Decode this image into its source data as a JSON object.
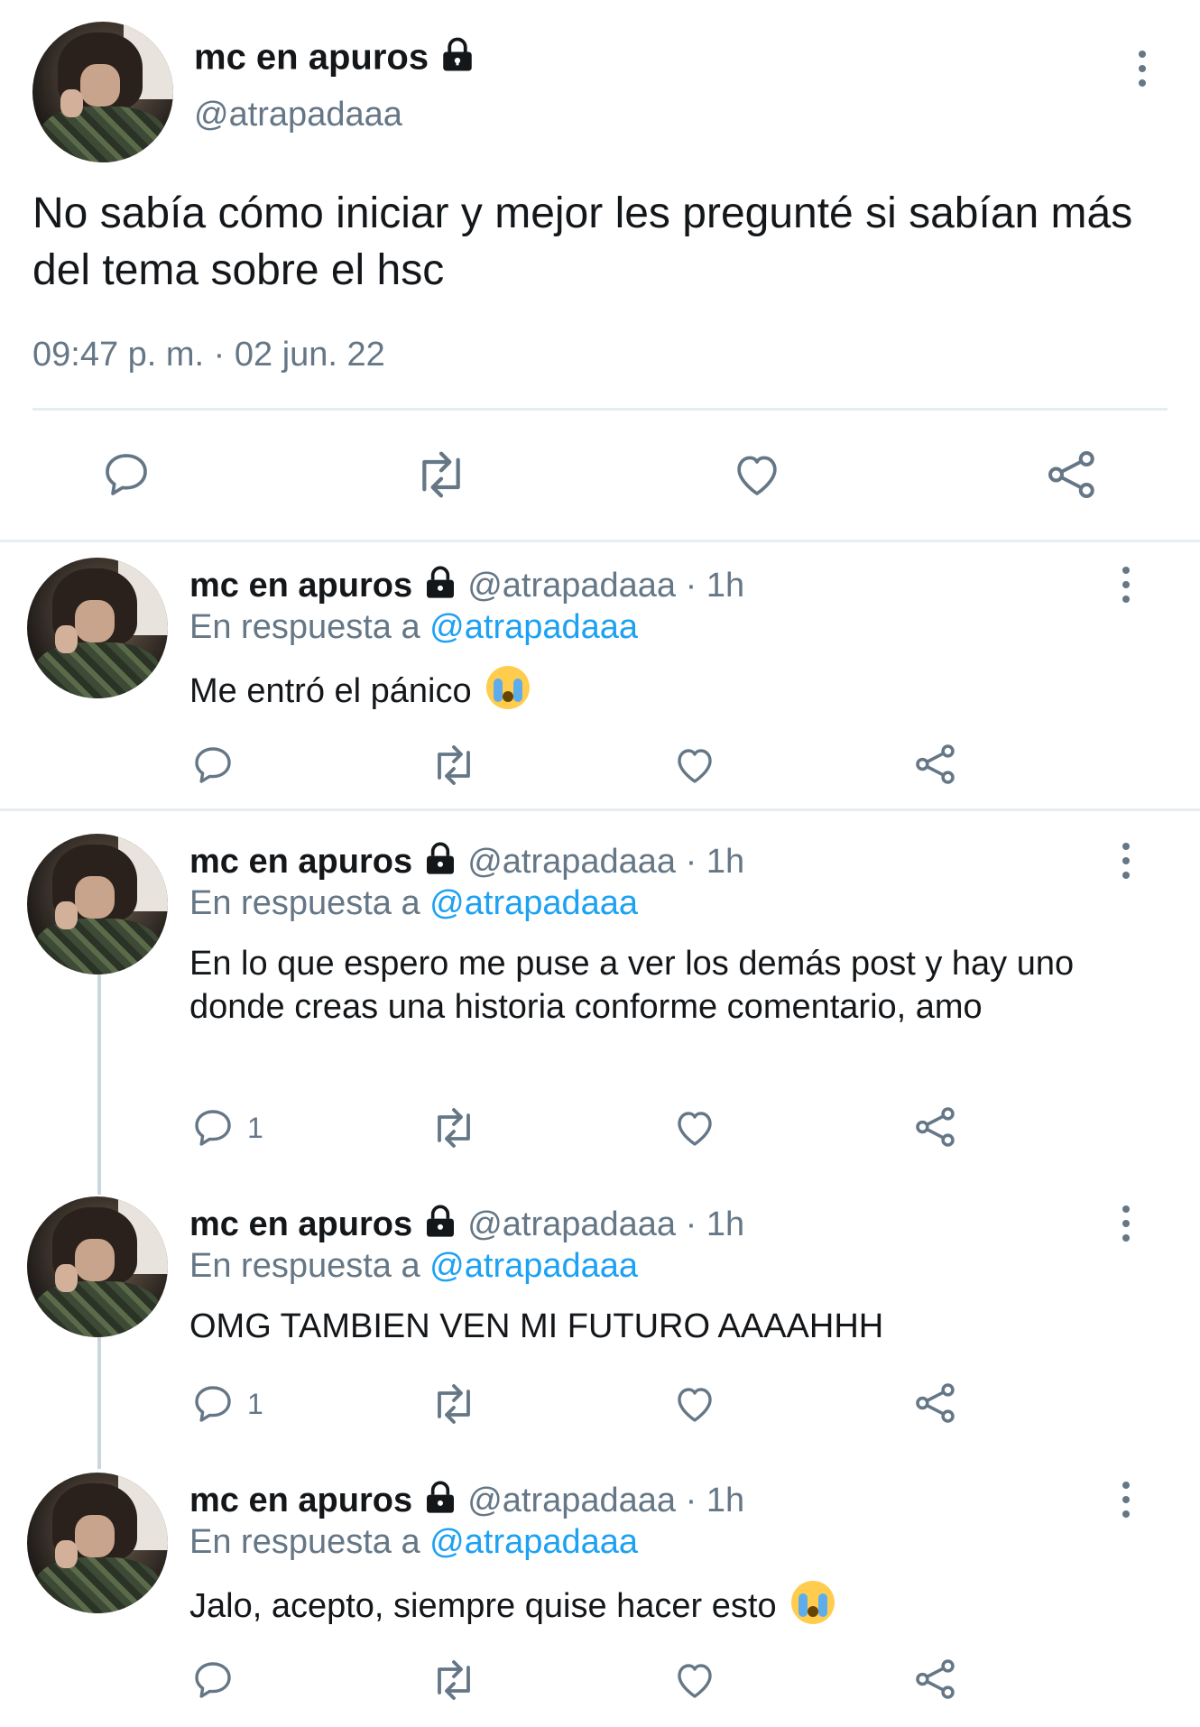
{
  "main_tweet": {
    "display_name": "mc en apuros",
    "handle": "@atrapadaaa",
    "text": "No sabía cómo iniciar y mejor les pregunté si sabían más del tema sobre el hsc",
    "timestamp": "09:47 p. m. · 02 jun. 22"
  },
  "actions": {
    "reply_icon": "reply-icon",
    "retweet_icon": "retweet-icon",
    "like_icon": "heart-icon",
    "share_icon": "share-icon"
  },
  "replies": [
    {
      "display_name": "mc en apuros",
      "handle": "@atrapadaaa · 1h",
      "reply_prefix": "En respuesta a ",
      "reply_to": "@atrapadaaa",
      "text": "Me entró el pánico",
      "emoji": "loudly-crying-face",
      "reply_count": ""
    },
    {
      "display_name": "mc en apuros",
      "handle": "@atrapadaaa · 1h",
      "reply_prefix": "En respuesta a ",
      "reply_to": "@atrapadaaa",
      "text": "En lo que espero me puse a ver los demás post y hay uno donde creas una historia conforme comentario, amo",
      "reply_count": "1"
    },
    {
      "display_name": "mc en apuros",
      "handle": "@atrapadaaa · 1h",
      "reply_prefix": "En respuesta a ",
      "reply_to": "@atrapadaaa",
      "text": "OMG TAMBIEN VEN MI FUTURO AAAAHHH",
      "reply_count": "1"
    },
    {
      "display_name": "mc en apuros",
      "handle": "@atrapadaaa · 1h",
      "reply_prefix": "En respuesta a ",
      "reply_to": "@atrapadaaa",
      "text": "Jalo, acepto, siempre quise hacer esto",
      "emoji": "loudly-crying-face",
      "reply_count": ""
    }
  ],
  "colors": {
    "text": "#14171a",
    "secondary": "#657786",
    "link": "#1da1f2",
    "divider": "#e6ecf0"
  }
}
